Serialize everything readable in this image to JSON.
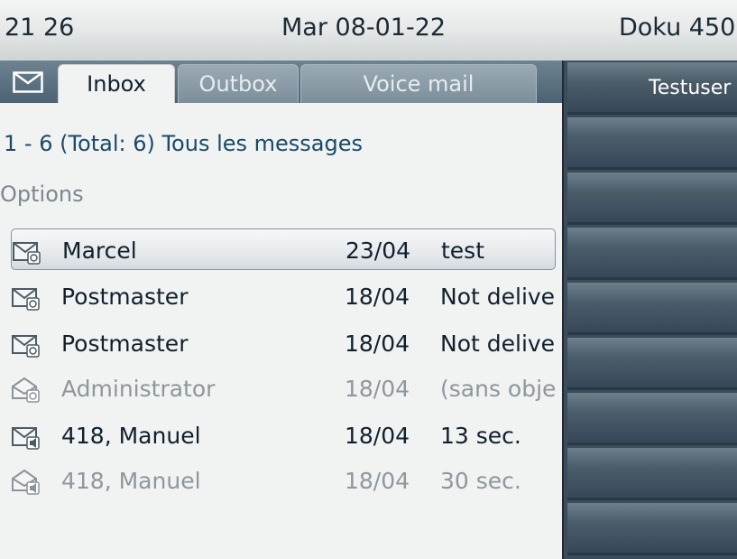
{
  "status_bar": {
    "time": "21 26",
    "date": "Mar 08-01-22",
    "user": "Doku 450"
  },
  "tabs": [
    {
      "label": "Inbox",
      "active": true
    },
    {
      "label": "Outbox",
      "active": false
    },
    {
      "label": "Voice mail",
      "active": false
    }
  ],
  "message_count": "1 - 6 (Total: 6) Tous les messages",
  "options_label": "Options",
  "messages": [
    {
      "sender": "Marcel",
      "date": "23/04",
      "subject": "test",
      "type": "email",
      "read": false,
      "selected": true
    },
    {
      "sender": "Postmaster",
      "date": "18/04",
      "subject": "Not delivered",
      "type": "email",
      "read": false,
      "selected": false
    },
    {
      "sender": "Postmaster",
      "date": "18/04",
      "subject": "Not delivered",
      "type": "email",
      "read": false,
      "selected": false
    },
    {
      "sender": "Administrator",
      "date": "18/04",
      "subject": "(sans objet)",
      "type": "email",
      "read": true,
      "selected": false
    },
    {
      "sender": "418, Manuel",
      "date": "18/04",
      "subject": "13 sec.",
      "type": "voice",
      "read": false,
      "selected": false
    },
    {
      "sender": "418, Manuel",
      "date": "18/04",
      "subject": "30 sec.",
      "type": "voice",
      "read": true,
      "selected": false
    }
  ],
  "right_panel": {
    "buttons": [
      "Testuser",
      "",
      "",
      "",
      "",
      "",
      "",
      "",
      ""
    ]
  },
  "colors": {
    "accent_text": "#1a4a67",
    "tab_bar": "#4b6272",
    "right_panel": "#3b4c5a",
    "read_text": "#8d979d"
  },
  "icons": {
    "tab": "envelope-icon",
    "email_unread": "envelope-closed-email-icon",
    "email_read": "envelope-open-email-icon",
    "voice_unread": "envelope-closed-voice-icon",
    "voice_read": "envelope-open-voice-icon"
  }
}
